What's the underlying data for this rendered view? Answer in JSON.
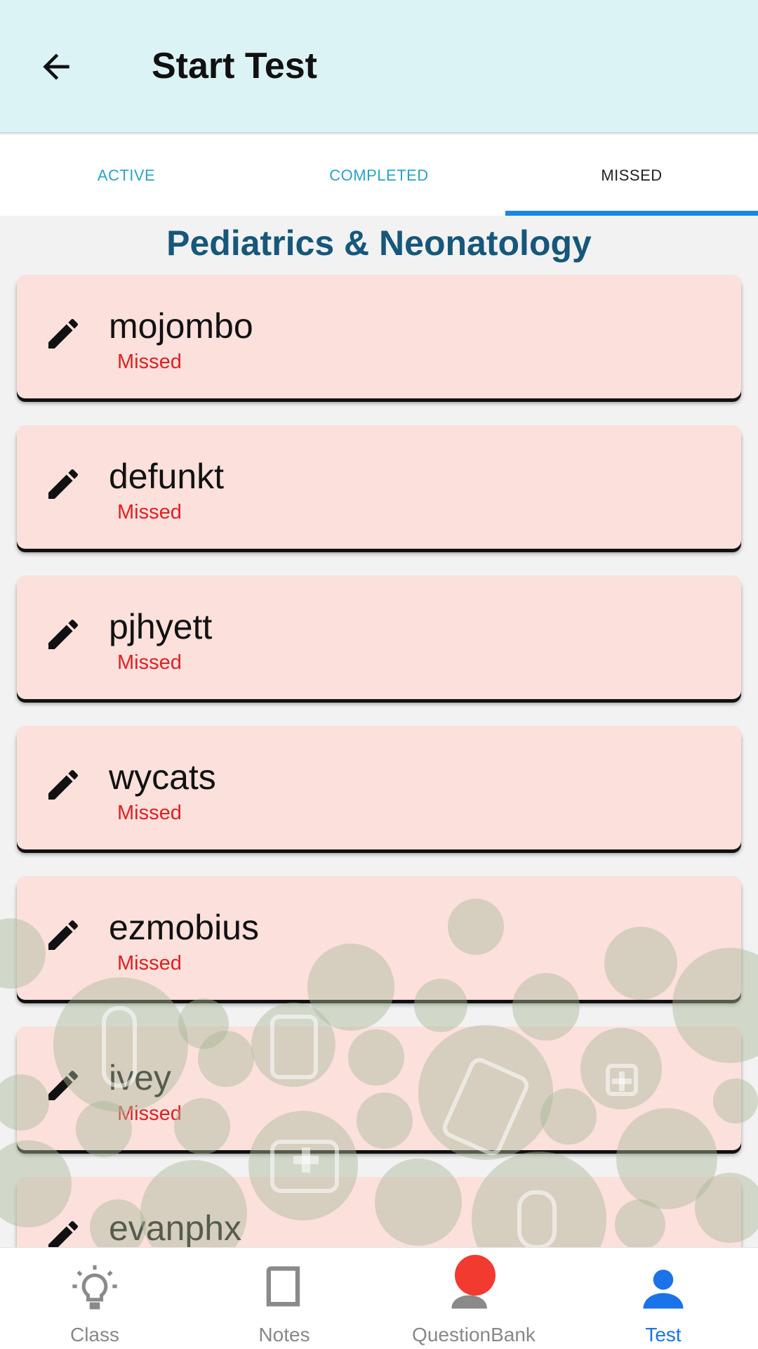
{
  "appbar": {
    "title": "Start Test",
    "back_icon": "arrow-left-icon"
  },
  "tabs": [
    {
      "label": "ACTIVE",
      "selected": false
    },
    {
      "label": "COMPLETED",
      "selected": false
    },
    {
      "label": "MISSED",
      "selected": true
    }
  ],
  "section": {
    "title": "Pediatrics & Neonatology"
  },
  "tests": [
    {
      "name": "mojombo",
      "status": "Missed",
      "icon": "pencil-icon"
    },
    {
      "name": "defunkt",
      "status": "Missed",
      "icon": "pencil-icon"
    },
    {
      "name": "pjhyett",
      "status": "Missed",
      "icon": "pencil-icon"
    },
    {
      "name": "wycats",
      "status": "Missed",
      "icon": "pencil-icon"
    },
    {
      "name": "ezmobius",
      "status": "Missed",
      "icon": "pencil-icon"
    },
    {
      "name": "ivey",
      "status": "Missed",
      "icon": "pencil-icon"
    },
    {
      "name": "evanphx",
      "status": "",
      "icon": "pencil-icon"
    }
  ],
  "bottom_nav": [
    {
      "label": "Class",
      "icon": "lightbulb-icon",
      "active": false
    },
    {
      "label": "Notes",
      "icon": "book-icon",
      "active": false
    },
    {
      "label": "QuestionBank",
      "icon": "person-badge-icon",
      "active": false
    },
    {
      "label": "Test",
      "icon": "person-icon",
      "active": true
    }
  ],
  "colors": {
    "appbar_bg": "#dcf3f6",
    "tab_indicator": "#1a86e8",
    "section_title": "#16577a",
    "card_bg": "#fbe0dc",
    "missed_text": "#e02020",
    "nav_active": "#1a73e8",
    "badge": "#f23a30"
  }
}
